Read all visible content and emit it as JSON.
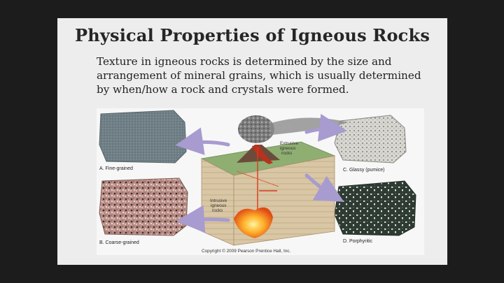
{
  "slide": {
    "title": "Physical Properties of Igneous Rocks",
    "body_lines": [
      "Texture in igneous rocks is determined by the size and",
      "arrangement of mineral grains, which is usually determined",
      "by when/how a rock and crystals were formed."
    ]
  },
  "figure": {
    "labels": {
      "fine_grained": "A. Fine-grained",
      "coarse_grained": "B. Coarse-grained",
      "glassy": "C. Glassy (pumice)",
      "porphyritic": "D. Porphyritic",
      "extrusive_1": "Extrusive",
      "extrusive_2": "igneous",
      "extrusive_3": "rocks",
      "intrusive_1": "Intrusive",
      "intrusive_2": "igneous",
      "intrusive_3": "rocks",
      "copyright": "Copyright © 2009 Pearson Prentice Hall, Inc."
    }
  }
}
